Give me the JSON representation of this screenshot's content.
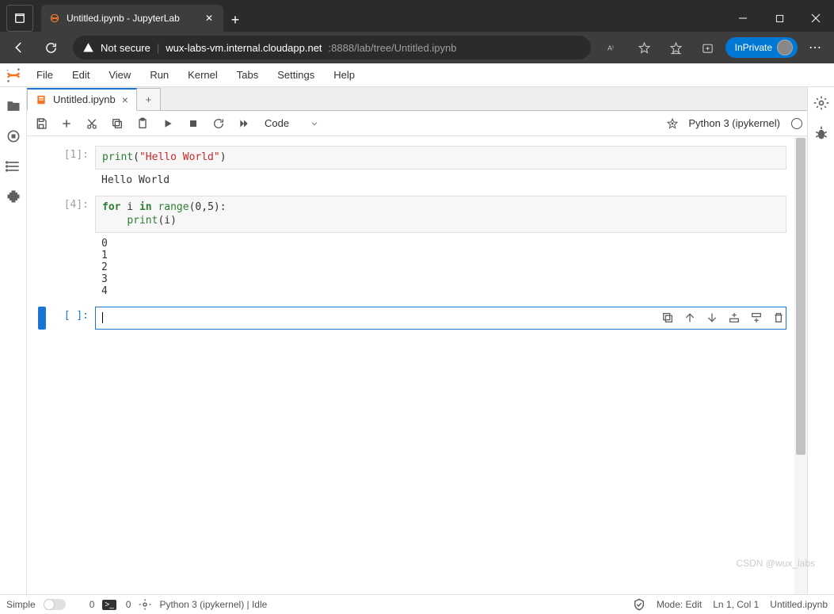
{
  "browser": {
    "tab_title": "Untitled.ipynb - JupyterLab",
    "not_secure": "Not secure",
    "url_host": "wux-labs-vm.internal.cloudapp.net",
    "url_port_path": ":8888/lab/tree/Untitled.ipynb",
    "inprivate": "InPrivate"
  },
  "menu": {
    "file": "File",
    "edit": "Edit",
    "view": "View",
    "run": "Run",
    "kernel": "Kernel",
    "tabs": "Tabs",
    "settings": "Settings",
    "help": "Help"
  },
  "doc_tab": {
    "name": "Untitled.ipynb"
  },
  "toolbar": {
    "cell_type": "Code"
  },
  "kernel": {
    "name": "Python 3 (ipykernel)"
  },
  "cells": {
    "c1": {
      "prompt": "[1]:",
      "print": "print",
      "str": "\"Hello World\"",
      "output": "Hello World"
    },
    "c2": {
      "prompt": "[4]:",
      "kw_for": "for",
      "var": " i ",
      "kw_in": "in",
      "range": " range",
      "args": "(0,5):",
      "indent": "    ",
      "print": "print",
      "arg2": "(i)",
      "output": "0\n1\n2\n3\n4"
    },
    "c3": {
      "prompt": "[ ]:"
    }
  },
  "status": {
    "simple": "Simple",
    "tabs_count": "0",
    "term_count": "0",
    "kernel_idle": "Python 3 (ipykernel) | Idle",
    "mode": "Mode: Edit",
    "lncol": "Ln 1, Col 1",
    "filename": "Untitled.ipynb"
  },
  "watermark": "CSDN @wux_labs"
}
